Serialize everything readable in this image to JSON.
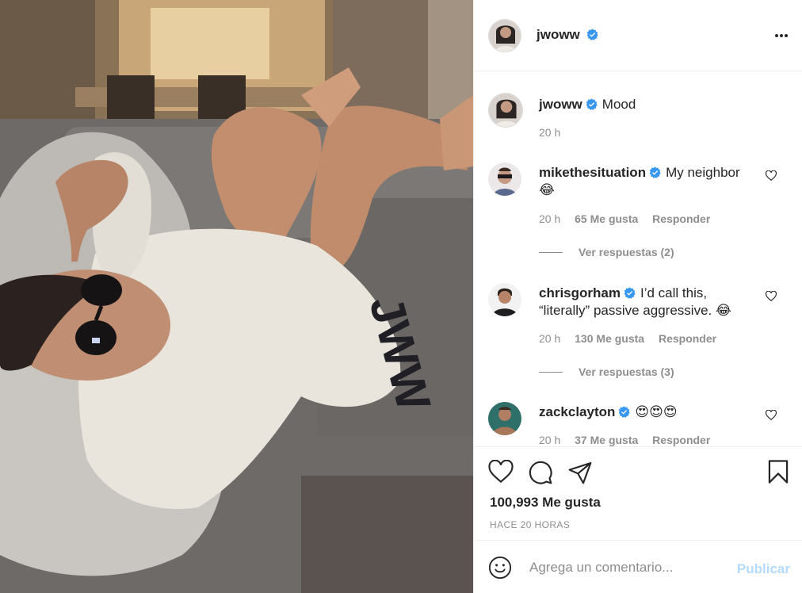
{
  "post": {
    "author": "jwoww",
    "caption": "Mood",
    "caption_time": "20 h",
    "likes_text": "100,993 Me gusta",
    "posted_ago": "HACE 20 HORAS",
    "image_shirt_text": "JWW"
  },
  "comments": [
    {
      "user": "mikethesituation",
      "line1": "My neighbor",
      "line2": "😂",
      "time": "20 h",
      "likes": "65 Me gusta",
      "reply": "Responder",
      "view_replies": "Ver respuestas (2)"
    },
    {
      "user": "chrisgorham",
      "line1": "I’d call this,",
      "line2": "“literally” passive aggressive. 😂",
      "time": "20 h",
      "likes": "130 Me gusta",
      "reply": "Responder",
      "view_replies": "Ver respuestas (3)"
    },
    {
      "user": "zackclayton",
      "line1": "😍😍😍",
      "line2": "",
      "time": "20 h",
      "likes": "37 Me gusta",
      "reply": "Responder"
    }
  ],
  "composer": {
    "placeholder": "Agrega un comentario...",
    "publish": "Publicar"
  },
  "icons": {
    "header": [
      "verified-badge-icon",
      "more-options-icon"
    ],
    "actions": [
      "heart-icon",
      "comment-icon",
      "share-icon",
      "bookmark-icon"
    ],
    "composer": "emoji-icon"
  },
  "colors": {
    "verified": "#3897f0",
    "text": "#262626",
    "muted": "#8e8e8e",
    "publish_disabled": "#b3dbff",
    "divider": "#efefef"
  }
}
